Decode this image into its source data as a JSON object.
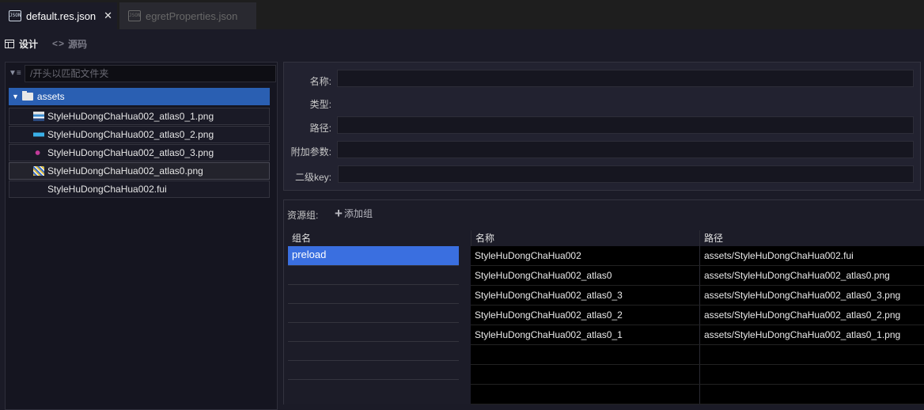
{
  "tabs": [
    {
      "label": "default.res.json",
      "close": "✕"
    },
    {
      "label": "egretProperties.json"
    }
  ],
  "toolbar": {
    "design_label": "设计",
    "source_label": "源码"
  },
  "left": {
    "filter_placeholder": "/开头以匹配文件夹",
    "folder": "assets",
    "files": [
      "StyleHuDongChaHua002_atlas0_1.png",
      "StyleHuDongChaHua002_atlas0_2.png",
      "StyleHuDongChaHua002_atlas0_3.png",
      "StyleHuDongChaHua002_atlas0.png",
      "StyleHuDongChaHua002.fui"
    ]
  },
  "props": {
    "name_label": "名称:",
    "type_label": "类型:",
    "path_label": "路径:",
    "extra_label": "附加参数:",
    "subkey_label": "二级key:"
  },
  "resources": {
    "title": "资源组:",
    "add_group": "添加组",
    "group_header": "组名",
    "groups": [
      "preload"
    ],
    "col_name": "名称",
    "col_path": "路径",
    "rows": [
      {
        "name": "StyleHuDongChaHua002",
        "path": "assets/StyleHuDongChaHua002.fui"
      },
      {
        "name": "StyleHuDongChaHua002_atlas0",
        "path": "assets/StyleHuDongChaHua002_atlas0.png"
      },
      {
        "name": "StyleHuDongChaHua002_atlas0_3",
        "path": "assets/StyleHuDongChaHua002_atlas0_3.png"
      },
      {
        "name": "StyleHuDongChaHua002_atlas0_2",
        "path": "assets/StyleHuDongChaHua002_atlas0_2.png"
      },
      {
        "name": "StyleHuDongChaHua002_atlas0_1",
        "path": "assets/StyleHuDongChaHua002_atlas0_1.png"
      }
    ]
  },
  "colors": {
    "accent": "#3a6fe0",
    "tree_selected": "#2a5fb2",
    "background": "#1b1b27"
  }
}
